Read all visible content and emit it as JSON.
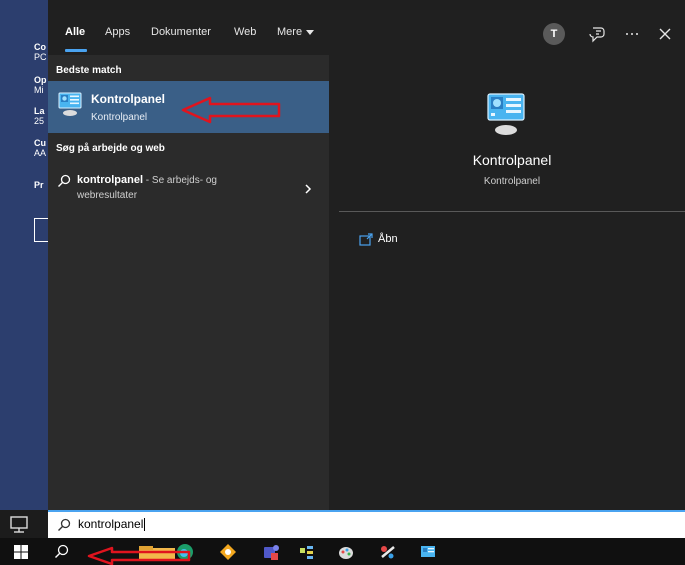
{
  "background_app": {
    "lines": [
      {
        "bold": "Co",
        "sub": "PC"
      },
      {
        "bold": "Op",
        "sub": "Mi"
      },
      {
        "bold": "La",
        "sub": "25"
      },
      {
        "bold": "Cu",
        "sub": "AA"
      },
      {
        "bold": "Pr",
        "sub": ""
      }
    ]
  },
  "tabs": [
    {
      "label": "Alle"
    },
    {
      "label": "Apps"
    },
    {
      "label": "Dokumenter"
    },
    {
      "label": "Web"
    },
    {
      "label": "Mere"
    }
  ],
  "header": {
    "avatar_initial": "T"
  },
  "results": {
    "best_match_heading": "Bedste match",
    "best_match": {
      "title": "Kontrolpanel",
      "subtitle": "Kontrolpanel",
      "icon": "control-panel-icon"
    },
    "web_heading": "Søg på arbejde og web",
    "web_item": {
      "term": "kontrolpanel",
      "suffix": " - Se arbejds- og",
      "suffix_line2": "webresultater"
    }
  },
  "details": {
    "title": "Kontrolpanel",
    "subtitle": "Kontrolpanel",
    "open_label": "Åbn"
  },
  "search": {
    "value": "kontrolpanel"
  },
  "colors": {
    "accent": "#4aa3f0",
    "selection": "#3a5f87",
    "annotation_red": "#e0141e"
  }
}
